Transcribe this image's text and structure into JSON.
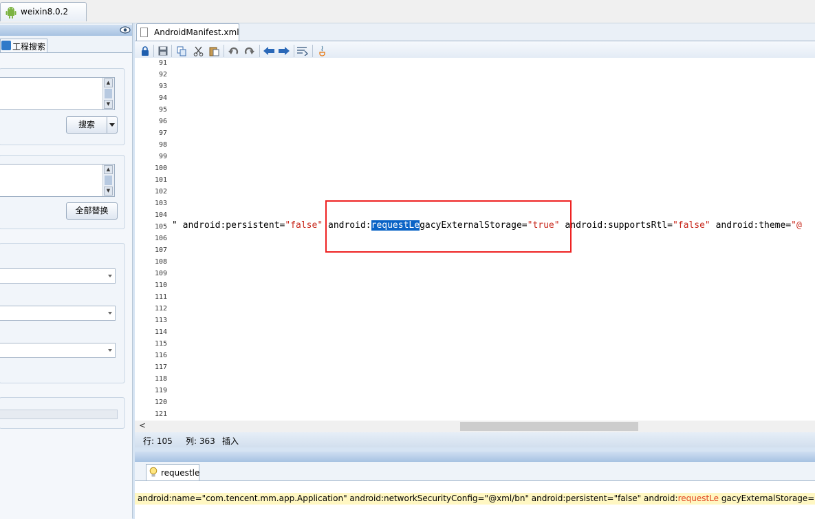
{
  "window": {
    "tab_label": "weixin8.0.2"
  },
  "left_panel": {
    "tab_label": "工程搜索",
    "search_button": "搜索",
    "replace_all_button": "全部替换"
  },
  "editor": {
    "file_tab": "AndroidManifest.xml",
    "line_numbers": [
      "91",
      "92",
      "93",
      "94",
      "95",
      "96",
      "97",
      "98",
      "99",
      "100",
      "101",
      "102",
      "103",
      "104",
      "105",
      "106",
      "107",
      "108",
      "109",
      "110",
      "111",
      "112",
      "113",
      "114",
      "115",
      "116",
      "117",
      "118",
      "119",
      "120",
      "121"
    ],
    "code": {
      "p1": "\" android:persistent=",
      "v1": "\"false\"",
      "p2": " android:",
      "selected": "requestLe",
      "p3": "gacyExternalStorage=",
      "v2": "\"true\"",
      "p4": " android:supportsRtl=",
      "v3": "\"false\"",
      "p5": " android:theme=",
      "v4": "\"@"
    },
    "status": {
      "row": "行: 105",
      "col": "列: 363",
      "mode": "插入"
    },
    "hscroll_left": "<"
  },
  "bottom_panel": {
    "tab_label": "requestle",
    "result": {
      "before": "android:name=\"com.tencent.mm.app.Application\" android:networkSecurityConfig=\"@xml/bn\" android:persistent=\"false\" android:",
      "match": "requestLe",
      "after": " gacyExternalStorage=\"true\" a"
    }
  }
}
